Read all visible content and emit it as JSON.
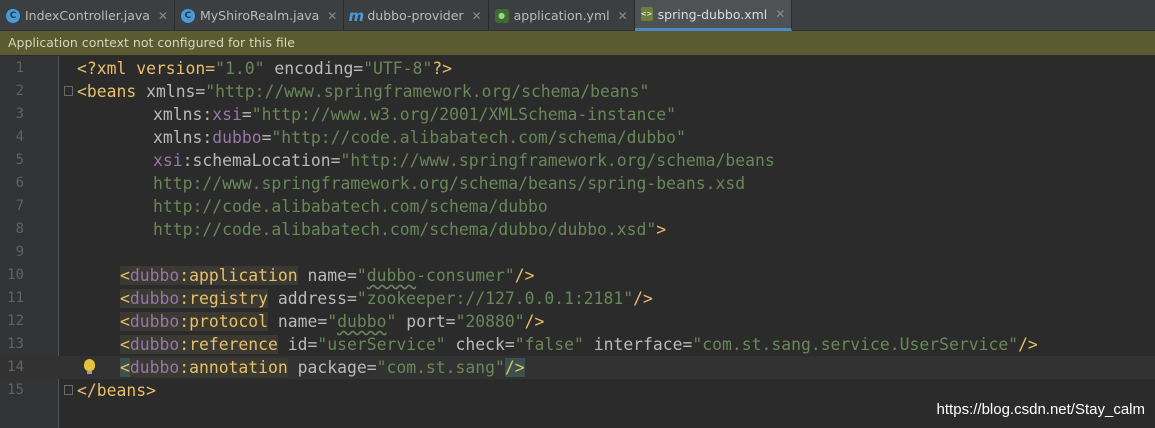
{
  "tabs": [
    {
      "label": "IndexController.java",
      "icon": "class-c-icon",
      "active": false
    },
    {
      "label": "MyShiroRealm.java",
      "icon": "class-c-icon",
      "active": false
    },
    {
      "label": "dubbo-provider",
      "icon": "maven-m-icon",
      "active": false
    },
    {
      "label": "application.yml",
      "icon": "yml-icon",
      "active": false
    },
    {
      "label": "spring-dubbo.xml",
      "icon": "xml-icon",
      "active": true
    }
  ],
  "notice": "Application context not configured for this file",
  "line_numbers": [
    "1",
    "2",
    "3",
    "4",
    "5",
    "6",
    "7",
    "8",
    "9",
    "10",
    "11",
    "12",
    "13",
    "14",
    "15"
  ],
  "code": {
    "l1": {
      "a": "<?xml version=",
      "b": "\"1.0\"",
      "c": " encoding=",
      "d": "\"UTF-8\"",
      "e": "?>"
    },
    "l2": {
      "a": "<beans",
      "b": " xmlns=",
      "c": "\"http://www.springframework.org/schema/beans\""
    },
    "l3": {
      "a": "xmlns:",
      "b": "xsi",
      "c": "=",
      "d": "\"http://www.w3.org/2001/XMLSchema-instance\""
    },
    "l4": {
      "a": "xmlns:",
      "b": "dubbo",
      "c": "=",
      "d": "\"http://code.alibabatech.com/schema/dubbo\""
    },
    "l5": {
      "a": "xsi",
      "b": ":schemaLocation=",
      "c": "\"http://www.springframework.org/schema/beans"
    },
    "l6": {
      "a": "http://www.springframework.org/schema/beans/spring-beans.xsd"
    },
    "l7": {
      "a": "http://code.alibabatech.com/schema/dubbo"
    },
    "l8": {
      "a": "http://code.alibabatech.com/schema/dubbo/dubbo.xsd\"",
      "b": ">"
    },
    "l10": {
      "lt": "<",
      "ns": "dubbo",
      "tag": ":application",
      "attr": " name=",
      "q1": "\"",
      "val": "dubbo",
      "val2": "-consumer",
      "q2": "\"",
      "end": "/>"
    },
    "l11": {
      "lt": "<",
      "ns": "dubbo",
      "tag": ":registry",
      "attr": " address=",
      "val": "\"zookeeper://127.0.0.1:2181\"",
      "end": "/>"
    },
    "l12": {
      "lt": "<",
      "ns": "dubbo",
      "tag": ":protocol",
      "attr": " name=",
      "q1": "\"",
      "val": "dubbo",
      "q2": "\"",
      "attr2": " port=",
      "val2": "\"20880\"",
      "end": "/>"
    },
    "l13": {
      "lt": "<",
      "ns": "dubbo",
      "tag": ":reference",
      "attr": " id=",
      "val": "\"userService\"",
      "attr2": " check=",
      "val2": "\"false\"",
      "attr3": " interface=",
      "val3": "\"com.st.sang.service.UserService\"",
      "end": "/>"
    },
    "l14": {
      "lt": "<",
      "ns": "dubbo",
      "tag": ":annotation",
      "attr": " package=",
      "val": "\"com.st.sang\"",
      "end": "/>"
    },
    "l15": {
      "a": "</beans>"
    }
  },
  "watermark": "https://blog.csdn.net/Stay_calm",
  "colors": {
    "tag": "#e8bf6a",
    "namespace": "#9876aa",
    "value": "#6a8759",
    "attr": "#bababa",
    "accent": "#4a88c7"
  }
}
